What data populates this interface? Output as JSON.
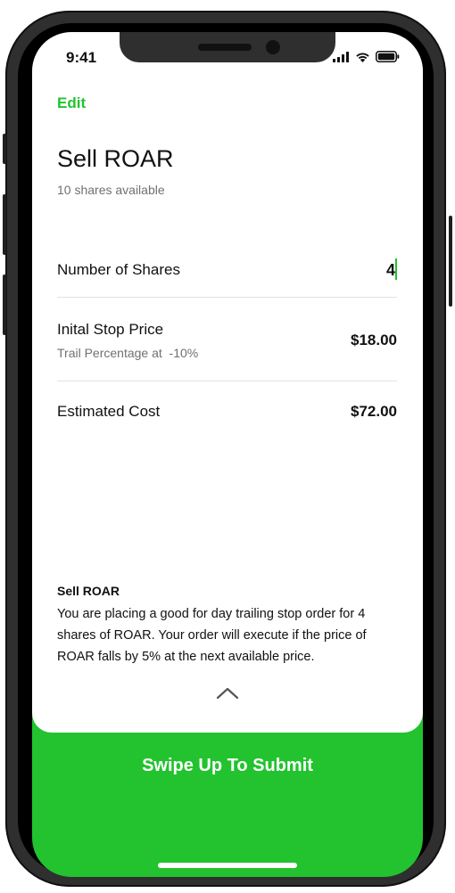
{
  "status_bar": {
    "time": "9:41",
    "icons": [
      "cellular-signal-icon",
      "wifi-icon",
      "battery-icon"
    ]
  },
  "header": {
    "edit_label": "Edit",
    "title": "Sell ROAR",
    "subtitle": "10 shares available"
  },
  "order": {
    "shares_label": "Number of Shares",
    "shares_value": "4",
    "stop_price_label": "Inital Stop Price",
    "trail_label": "Trail Percentage at  -10%",
    "stop_price_value": "$18.00",
    "estimated_cost_label": "Estimated Cost",
    "estimated_cost_value": "$72.00"
  },
  "summary": {
    "title": "Sell ROAR",
    "body": "You are placing a good for day trailing stop order for 4 shares of ROAR. Your order will execute if the price of ROAR falls by 5% at the next available price."
  },
  "footer": {
    "submit_label": "Swipe Up To Submit",
    "expand_icon": "chevron-up-icon"
  },
  "colors": {
    "accent": "#22c32e",
    "text": "#111111",
    "muted": "#707070",
    "divider": "#e2e2e2",
    "frame": "#2f2f2f"
  }
}
